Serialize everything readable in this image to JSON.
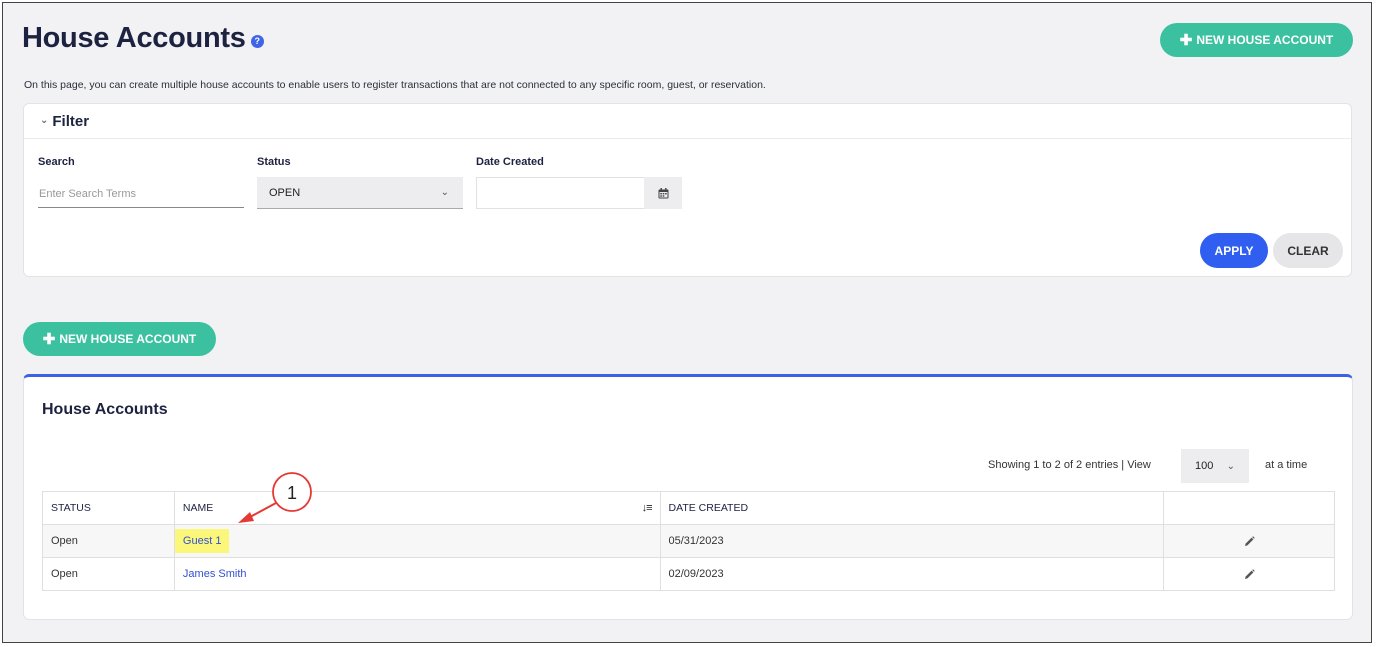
{
  "header": {
    "title": "House Accounts",
    "help_icon": "?",
    "new_button_label": "NEW HOUSE ACCOUNT",
    "description": "On this page, you can create multiple house accounts to enable users to register transactions that are not connected to any specific room, guest, or reservation."
  },
  "filter": {
    "title": "Filter",
    "search_label": "Search",
    "search_placeholder": "Enter Search Terms",
    "search_value": "",
    "status_label": "Status",
    "status_value": "OPEN",
    "date_label": "Date Created",
    "date_value": "",
    "apply_label": "APPLY",
    "clear_label": "CLEAR"
  },
  "mid_button_label": "NEW HOUSE ACCOUNT",
  "table_card": {
    "title": "House Accounts",
    "showing_text": "Showing 1 to 2 of 2 entries | View",
    "page_size": "100",
    "at_time": "at a time",
    "columns": [
      "STATUS",
      "NAME",
      "DATE CREATED",
      ""
    ],
    "rows": [
      {
        "status": "Open",
        "name": "Guest 1",
        "date": "05/31/2023"
      },
      {
        "status": "Open",
        "name": "James Smith",
        "date": "02/09/2023"
      }
    ]
  },
  "annotation": {
    "number": "1",
    "color": "#e53935"
  },
  "colors": {
    "accent_green": "#3cc1a0",
    "accent_blue": "#2f5ef0",
    "highlight": "#fbf77a"
  },
  "icons": [
    "help-icon",
    "plus-icon",
    "chevron-down-icon",
    "calendar-icon",
    "sort-icon",
    "pencil-icon"
  ]
}
